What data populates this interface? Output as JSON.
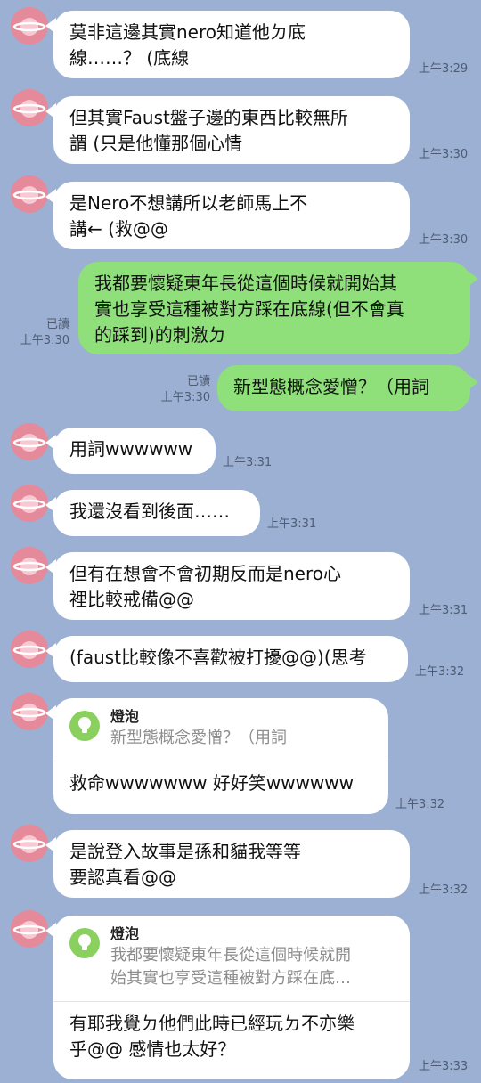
{
  "colors": {
    "background": "#9bb0d3",
    "incoming": "#ffffff",
    "outgoing": "#8fdf7a",
    "avatar": "#e48a9a"
  },
  "messages": [
    {
      "lines": [
        "莫非這邊其實nero知道他ㄉ底",
        "線……？ (底線"
      ],
      "time": "上午3:29"
    },
    {
      "lines": [
        "但其實Faust盤子邊的東西比較無所",
        "謂 (只是他懂那個心情"
      ],
      "time": "上午3:30"
    },
    {
      "lines": [
        "是Nero不想講所以老師馬上不",
        "講← (救@@"
      ],
      "time": "上午3:30"
    },
    {
      "lines": [
        "我都要懷疑東年長從這個時候就開始其",
        "實也享受這種被對方踩在底線(但不會真",
        "的踩到)的刺激ㄉ"
      ],
      "read": "已讀",
      "time": "上午3:30"
    },
    {
      "lines": [
        "新型態概念愛憎？（用詞"
      ],
      "read": "已讀",
      "time": "上午3:30"
    },
    {
      "lines": [
        "用詞wwwwww"
      ],
      "time": "上午3:31"
    },
    {
      "lines": [
        "我還沒看到後面……"
      ],
      "time": "上午3:31"
    },
    {
      "lines": [
        "但有在想會不會初期反而是nero心",
        "裡比較戒備@@"
      ],
      "time": "上午3:31"
    },
    {
      "lines": [
        "(faust比較像不喜歡被打擾@@)(思考"
      ],
      "time": "上午3:32"
    },
    {
      "reply_name": "燈泡",
      "reply_lines": [
        "新型態概念愛憎？（用詞"
      ],
      "lines": [
        "救命wwwwwww 好好笑wwwwww"
      ],
      "time": "上午3:32"
    },
    {
      "lines": [
        "是說登入故事是孫和貓我等等",
        "要認真看@@"
      ],
      "time": "上午3:32"
    },
    {
      "reply_name": "燈泡",
      "reply_lines": [
        "我都要懷疑東年長從這個時候就開",
        "始其實也享受這種被對方踩在底…"
      ],
      "lines": [
        "有耶我覺ㄉ他們此時已經玩ㄉ不亦樂",
        "乎@@ 感情也太好？"
      ],
      "time": "上午3:33"
    }
  ]
}
